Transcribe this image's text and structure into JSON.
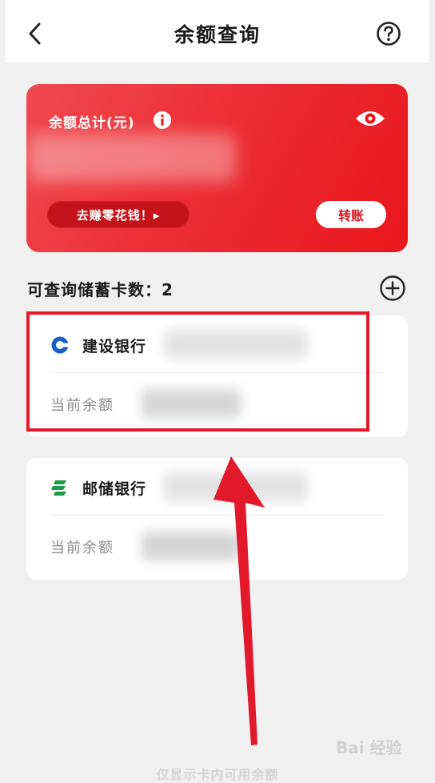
{
  "header": {
    "title": "余额查询"
  },
  "card": {
    "label": "余额总计(元)",
    "earn_button": "去赚零花钱！▸",
    "transfer_button": "转账"
  },
  "cards_section": {
    "count_label": "可查询储蓄卡数：2"
  },
  "banks": [
    {
      "name": "建设银行",
      "balance_label": "当前余额",
      "logo": "ccb-logo-icon",
      "logo_color": "#1a5fc8"
    },
    {
      "name": "邮储银行",
      "balance_label": "当前余额",
      "logo": "psbc-logo-icon",
      "logo_color": "#1f9a49"
    }
  ],
  "footer": {
    "note": "仅显示卡内可用余额"
  },
  "watermark": {
    "text": "Bai 经验"
  },
  "colors": {
    "accent": "#e8161c",
    "annotation": "#e5192a"
  }
}
